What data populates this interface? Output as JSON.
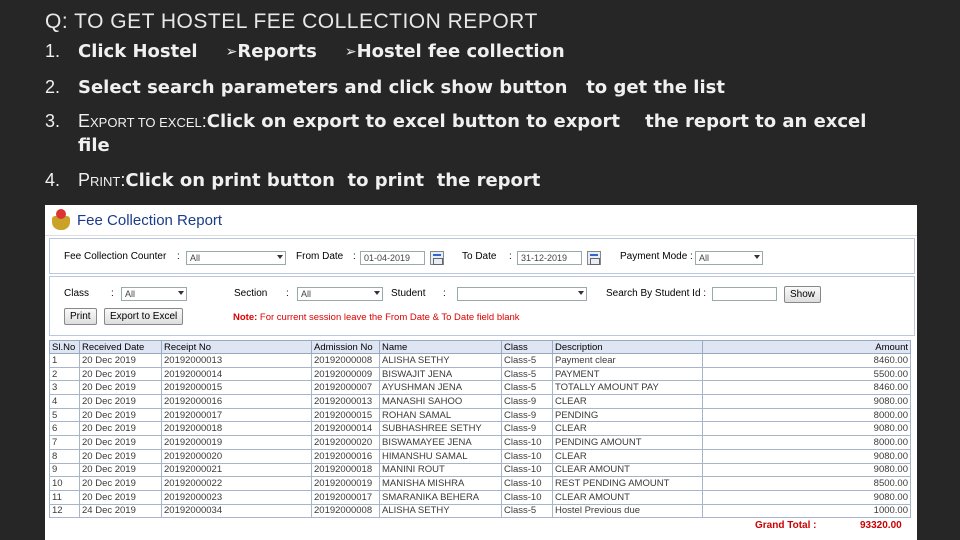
{
  "slide": {
    "title": "Q: TO GET HOSTEL FEE COLLECTION REPORT",
    "steps": [
      {
        "num": "1.",
        "parts": [
          "Click Hostel",
          "Reports",
          "Hostel fee collection"
        ]
      },
      {
        "num": "2.",
        "parts": [
          "Select search parameters and click show button",
          "to get the list"
        ]
      },
      {
        "num": "3.",
        "lead_big": "E",
        "lead_small": "XPORT TO EXCEL",
        "lead_colon": ":",
        "parts": [
          "Click on export to excel button to export",
          "the report to an excel"
        ],
        "cont": "file"
      },
      {
        "num": "4.",
        "lead_big": "P",
        "lead_small": "RINT",
        "lead_colon": ":",
        "parts": [
          "Click on print button",
          "to print",
          "the report"
        ]
      }
    ],
    "arrow_glyph": "➢"
  },
  "app": {
    "title": "Fee Collection Report",
    "filters": {
      "counter_label": "Fee Collection Counter",
      "counter_value": "All",
      "from_label": "From Date",
      "from_value": "01-04-2019",
      "to_label": "To Date",
      "to_value": "31-12-2019",
      "mode_label": "Payment Mode :",
      "mode_value": "All",
      "class_label": "Class",
      "class_value": "All",
      "section_label": "Section",
      "section_value": "All",
      "student_label": "Student",
      "student_value": "",
      "search_label": "Search By Student Id :",
      "search_value": "",
      "colon": ":"
    },
    "buttons": {
      "show": "Show",
      "print": "Print",
      "export": "Export to Excel"
    },
    "note": {
      "prefix": "Note:",
      "text": "For current session leave the From Date & To Date field blank"
    },
    "table": {
      "headers": [
        "Sl.No",
        "Received Date",
        "Receipt No",
        "Admission No",
        "Name",
        "Class",
        "Description",
        "Amount"
      ],
      "rows": [
        [
          "1",
          "20 Dec 2019",
          "20192000013",
          "20192000008",
          "ALISHA SETHY",
          "Class-5",
          "Payment clear",
          "8460.00"
        ],
        [
          "2",
          "20 Dec 2019",
          "20192000014",
          "20192000009",
          "BISWAJIT JENA",
          "Class-5",
          "PAYMENT",
          "5500.00"
        ],
        [
          "3",
          "20 Dec 2019",
          "20192000015",
          "20192000007",
          "AYUSHMAN JENA",
          "Class-5",
          "TOTALLY AMOUNT PAY",
          "8460.00"
        ],
        [
          "4",
          "20 Dec 2019",
          "20192000016",
          "20192000013",
          "MANASHI SAHOO",
          "Class-9",
          "CLEAR",
          "9080.00"
        ],
        [
          "5",
          "20 Dec 2019",
          "20192000017",
          "20192000015",
          "ROHAN SAMAL",
          "Class-9",
          "PENDING",
          "8000.00"
        ],
        [
          "6",
          "20 Dec 2019",
          "20192000018",
          "20192000014",
          "SUBHASHREE SETHY",
          "Class-9",
          "CLEAR",
          "9080.00"
        ],
        [
          "7",
          "20 Dec 2019",
          "20192000019",
          "20192000020",
          "BISWAMAYEE JENA",
          "Class-10",
          "PENDING AMOUNT",
          "8000.00"
        ],
        [
          "8",
          "20 Dec 2019",
          "20192000020",
          "20192000016",
          "HIMANSHU SAMAL",
          "Class-10",
          "CLEAR",
          "9080.00"
        ],
        [
          "9",
          "20 Dec 2019",
          "20192000021",
          "20192000018",
          "MANINI ROUT",
          "Class-10",
          "CLEAR AMOUNT",
          "9080.00"
        ],
        [
          "10",
          "20 Dec 2019",
          "20192000022",
          "20192000019",
          "MANISHA MISHRA",
          "Class-10",
          "REST PENDING AMOUNT",
          "8500.00"
        ],
        [
          "11",
          "20 Dec 2019",
          "20192000023",
          "20192000017",
          "SMARANIKA BEHERA",
          "Class-10",
          "CLEAR AMOUNT",
          "9080.00"
        ],
        [
          "12",
          "24 Dec 2019",
          "20192000034",
          "20192000008",
          "ALISHA SETHY",
          "Class-5",
          "Hostel Previous due",
          "1000.00"
        ]
      ]
    },
    "grand_total": {
      "label": "Grand Total",
      "colon": ":",
      "value": "93320.00"
    }
  },
  "colors": {
    "background": "#262626",
    "app_title": "#1a3c8a",
    "note": "#dd0000",
    "header_row": "#dfe6f3"
  }
}
